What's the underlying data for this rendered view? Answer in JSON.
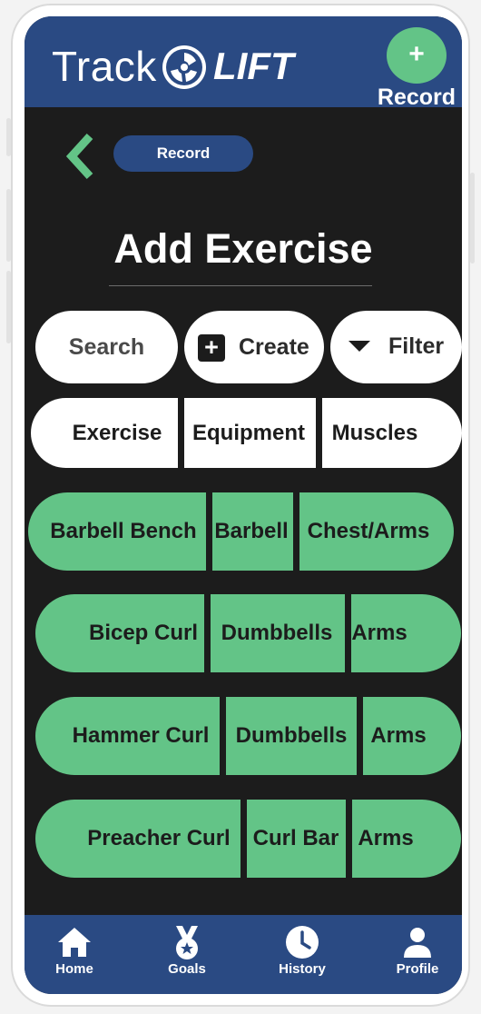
{
  "app": {
    "logo_track": "Track",
    "logo_lift": "LIFT"
  },
  "header": {
    "record_fab_symbol": "+",
    "record_label": "Record"
  },
  "breadcrumb": {
    "record_pill": "Record"
  },
  "page": {
    "title": "Add Exercise"
  },
  "toolbar": {
    "search_label": "Search",
    "create_label": "Create",
    "create_symbol": "+",
    "filter_label": "Filter"
  },
  "table": {
    "headers": [
      "Exercise",
      "Equipment",
      "Muscles"
    ],
    "rows": [
      [
        "Barbell Bench",
        "Barbell",
        "Chest/Arms"
      ],
      [
        "Bicep Curl",
        "Dumbbells",
        "Arms"
      ],
      [
        "Hammer Curl",
        "Dumbbells",
        "Arms"
      ],
      [
        "Preacher Curl",
        "Curl Bar",
        "Arms"
      ]
    ]
  },
  "nav": {
    "items": [
      {
        "label": "Home",
        "icon": "home-icon"
      },
      {
        "label": "Goals",
        "icon": "medal-icon"
      },
      {
        "label": "History",
        "icon": "clock-icon"
      },
      {
        "label": "Profile",
        "icon": "person-icon"
      }
    ]
  },
  "colors": {
    "brand_blue": "#2a4a83",
    "accent_green": "#63c487",
    "background": "#1c1c1c"
  }
}
